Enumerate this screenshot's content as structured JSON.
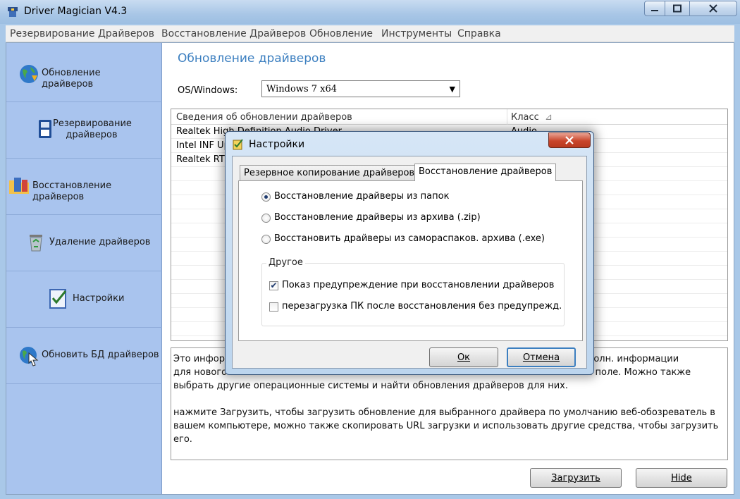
{
  "window": {
    "title": "Driver Magician V4.3"
  },
  "menubar": {
    "items": [
      "Резервирование Драйверов",
      "Восстановление Драйверов",
      "Обновление",
      "Инструменты",
      "Справка"
    ]
  },
  "sidebar": {
    "items": [
      {
        "label": "Обновление драйверов",
        "icon": "globe-update-icon"
      },
      {
        "label": "Резервирование драйверов",
        "icon": "backup-disk-icon"
      },
      {
        "label": "Восстановление драйверов",
        "icon": "restore-folder-icon"
      },
      {
        "label": "Удаление драйверов",
        "icon": "recycle-bin-icon"
      },
      {
        "label": "Настройки",
        "icon": "settings-checklist-icon"
      },
      {
        "label": "Обновить БД драйверов",
        "icon": "globe-cursor-icon"
      }
    ]
  },
  "main": {
    "title": "Обновление драйверов",
    "os_label": "OS/Windows:",
    "os_value": "Windows 7 x64",
    "table": {
      "columns": [
        "Сведения об обновлении драйверов",
        "Класс"
      ],
      "rows": [
        [
          "Realtek High Definition Audio Driver",
          "Audio"
        ],
        [
          "Intel INF Update",
          ""
        ],
        [
          "Realtek RTL",
          ""
        ]
      ]
    },
    "info": {
      "paragraph1": "Это информ... выбрать другие операционные системы и найти обновления драйверов для них.",
      "line1": "Это информ",
      "line1_end": "ения дополн. информации",
      "line2": "для нового",
      "line2_end": "овом поле. Можно также",
      "line3": "выбрать другие операционные системы и найти обновления драйверов для них.",
      "paragraph2": "нажмите Загрузить, чтобы загрузить обновление для выбранного драйвера по умолчанию веб-обозреватель в вашем компьютере, можно также скопировать URL загрузки и использовать другие средства, чтобы загрузить его."
    },
    "buttons": {
      "download": "Загрузить",
      "hide": "Hide"
    }
  },
  "dialog": {
    "title": "Настройки",
    "tabs": [
      "Резервное копирование драйверов",
      "Восстановление драйверов"
    ],
    "active_tab": 1,
    "options": [
      {
        "label": "Восстановление драйверы из папок",
        "selected": true
      },
      {
        "label": "Восстановление драйверы из архива (.zip)",
        "selected": false
      },
      {
        "label": "Восстановить драйверы из самораспаков. архива (.exe)",
        "selected": false
      }
    ],
    "group": {
      "legend": "Другое",
      "checks": [
        {
          "label": "Показ предупреждение при восстановлении драйверов",
          "checked": true,
          "mark": "✔"
        },
        {
          "label": "перезагрузка ПК после восстановления без предупрежд.",
          "checked": false,
          "mark": ""
        }
      ]
    },
    "ok": "Ок",
    "cancel": "Отмена"
  },
  "colors": {
    "sidebar_bg": "#a9c4ee",
    "title_accent": "#3c7fc0",
    "close_red": "#c9452b"
  }
}
